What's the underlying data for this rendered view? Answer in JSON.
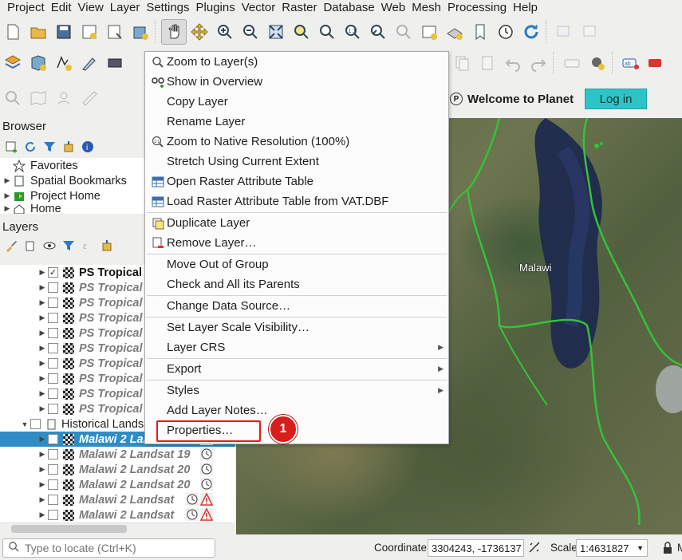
{
  "menubar": [
    "Project",
    "Edit",
    "View",
    "Layer",
    "Settings",
    "Plugins",
    "Vector",
    "Raster",
    "Database",
    "Web",
    "Mesh",
    "Processing",
    "Help"
  ],
  "planet": {
    "welcome": "Welcome to Planet",
    "login": "Log in",
    "icon_letter": "P"
  },
  "browser": {
    "title": "Browser",
    "items": [
      "Favorites",
      "Spatial Bookmarks",
      "Project Home",
      "Home"
    ]
  },
  "layers": {
    "title": "Layers",
    "rows": [
      {
        "name": "PS Tropical",
        "bold_black": true,
        "checked": true
      },
      {
        "name": "PS Tropical"
      },
      {
        "name": "PS Tropical"
      },
      {
        "name": "PS Tropical"
      },
      {
        "name": "PS Tropical"
      },
      {
        "name": "PS Tropical"
      },
      {
        "name": "PS Tropical"
      },
      {
        "name": "PS Tropical"
      },
      {
        "name": "PS Tropical"
      },
      {
        "name": "PS Tropical"
      }
    ],
    "group": "Historical Landsat",
    "group_rows": [
      {
        "name": "Malawi 2 Landsat 19",
        "selected": true
      },
      {
        "name": "Malawi 2 Landsat 19"
      },
      {
        "name": "Malawi 2 Landsat 20"
      },
      {
        "name": "Malawi 2 Landsat 20"
      },
      {
        "name": "Malawi 2 Landsat",
        "warn": true
      },
      {
        "name": "Malawi 2 Landsat",
        "warn": true
      }
    ]
  },
  "map": {
    "label": "Malawi"
  },
  "context_menu": {
    "items": [
      {
        "label": "Zoom to Layer(s)",
        "icon": "zoom-layer-icon"
      },
      {
        "label": "Show in Overview",
        "icon": "overview-icon"
      },
      {
        "label": "Copy Layer"
      },
      {
        "label": "Rename Layer"
      },
      {
        "label": "Zoom to Native Resolution (100%)",
        "icon": "native-resolution-icon"
      },
      {
        "label": "Stretch Using Current Extent"
      },
      {
        "label": "Open Raster Attribute Table",
        "icon": "table-icon"
      },
      {
        "label": "Load Raster Attribute Table from VAT.DBF",
        "icon": "table-icon",
        "sep_after": true
      },
      {
        "label": "Duplicate Layer",
        "icon": "duplicate-icon"
      },
      {
        "label": "Remove Layer…",
        "icon": "remove-icon",
        "sep_after": true
      },
      {
        "label": "Move Out of Group"
      },
      {
        "label": "Check and All its Parents",
        "sep_after": true
      },
      {
        "label": "Change Data Source…",
        "sep_after": true
      },
      {
        "label": "Set Layer Scale Visibility…"
      },
      {
        "label": "Layer CRS",
        "submenu": true
      },
      {
        "label": "Export",
        "submenu": true,
        "sep_before": true,
        "sep_after": true
      },
      {
        "label": "Styles",
        "submenu": true
      },
      {
        "label": "Add Layer Notes…"
      },
      {
        "label": "Properties…"
      }
    ],
    "marker": "1"
  },
  "status": {
    "locator_placeholder": "Type to locate (Ctrl+K)",
    "coordinate_label": "Coordinate",
    "coordinate_value": "3304243, -1736137",
    "scale_label": "Scale",
    "scale_value": "1:4631827",
    "trailing_label": "M"
  }
}
